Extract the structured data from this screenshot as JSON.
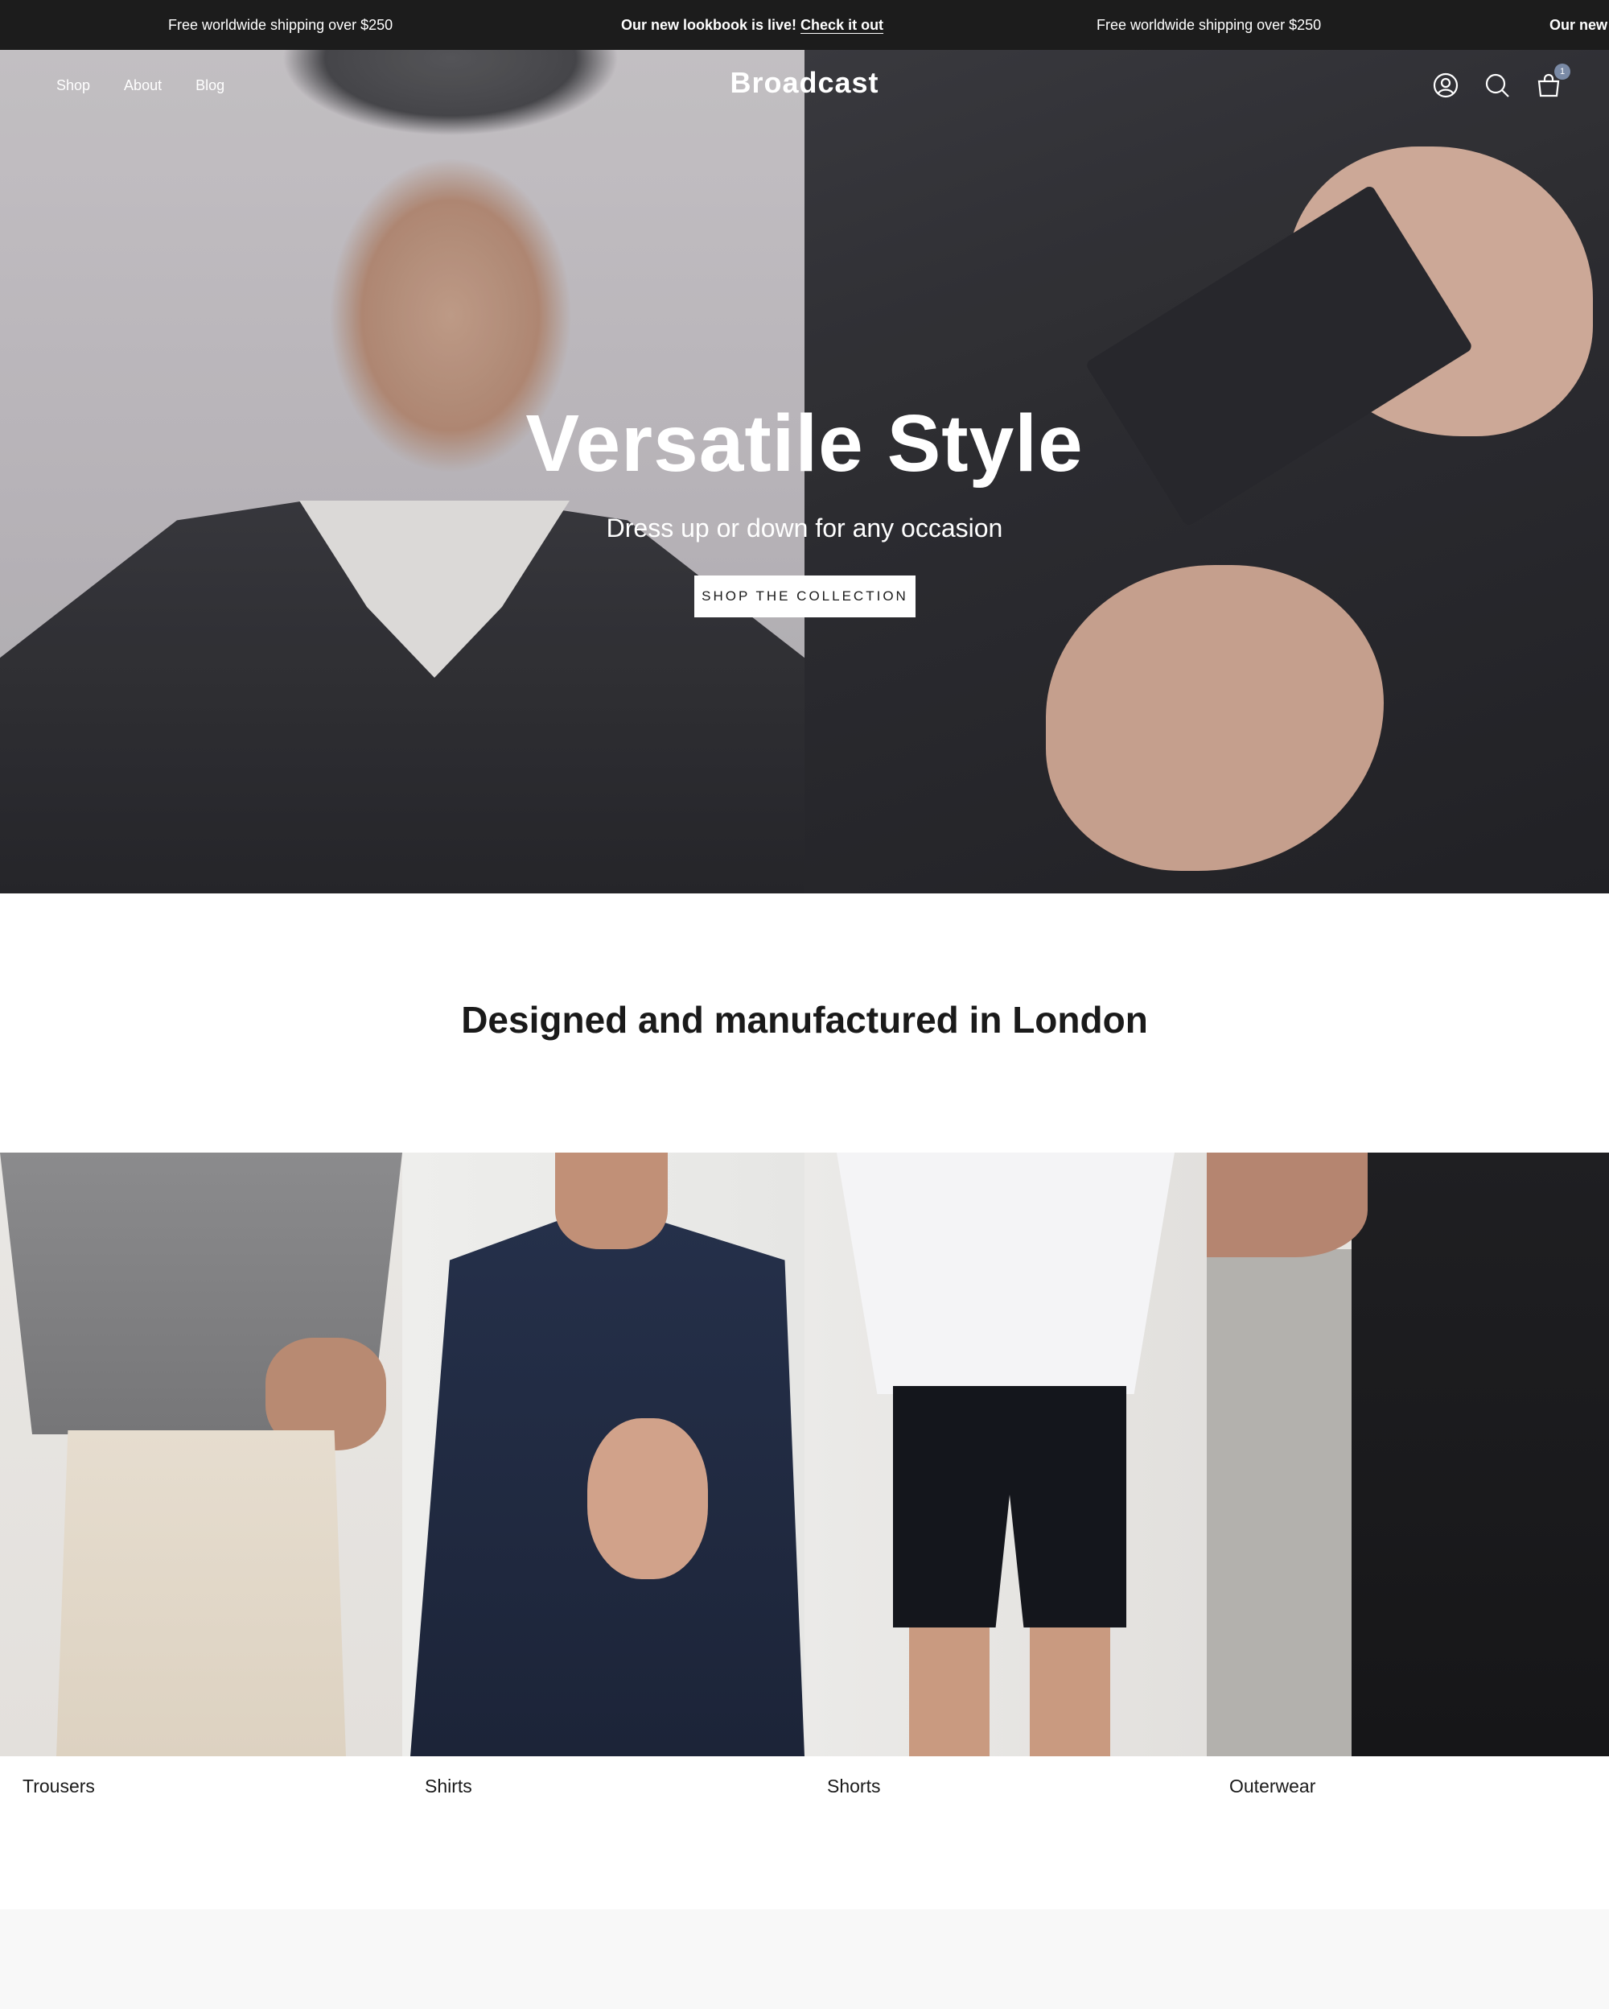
{
  "announcement": {
    "messages": [
      {
        "text": "Free worldwide shipping over $250"
      },
      {
        "text": "Our new lookbook is live! ",
        "link": "Check it out"
      },
      {
        "text": "Free worldwide shipping over $250"
      },
      {
        "text": "Our new"
      }
    ]
  },
  "nav": {
    "links": [
      "Shop",
      "About",
      "Blog"
    ],
    "logo": "Broadcast",
    "cart_count": "1",
    "icons": [
      "account-icon",
      "search-icon",
      "cart-icon"
    ]
  },
  "hero": {
    "title": "Versatile Style",
    "subtitle": "Dress up or down for any occasion",
    "button": "SHOP THE COLLECTION"
  },
  "section": {
    "heading": "Designed and manufactured in London"
  },
  "collections": [
    {
      "label": "Trousers"
    },
    {
      "label": "Shirts"
    },
    {
      "label": "Shorts"
    },
    {
      "label": "Outerwear"
    }
  ],
  "colors": {
    "announcement_bg": "#1c1c1c",
    "text": "#1a1a1a",
    "badge": "#7a8aa6",
    "footer_bg": "#f8f8f8"
  }
}
